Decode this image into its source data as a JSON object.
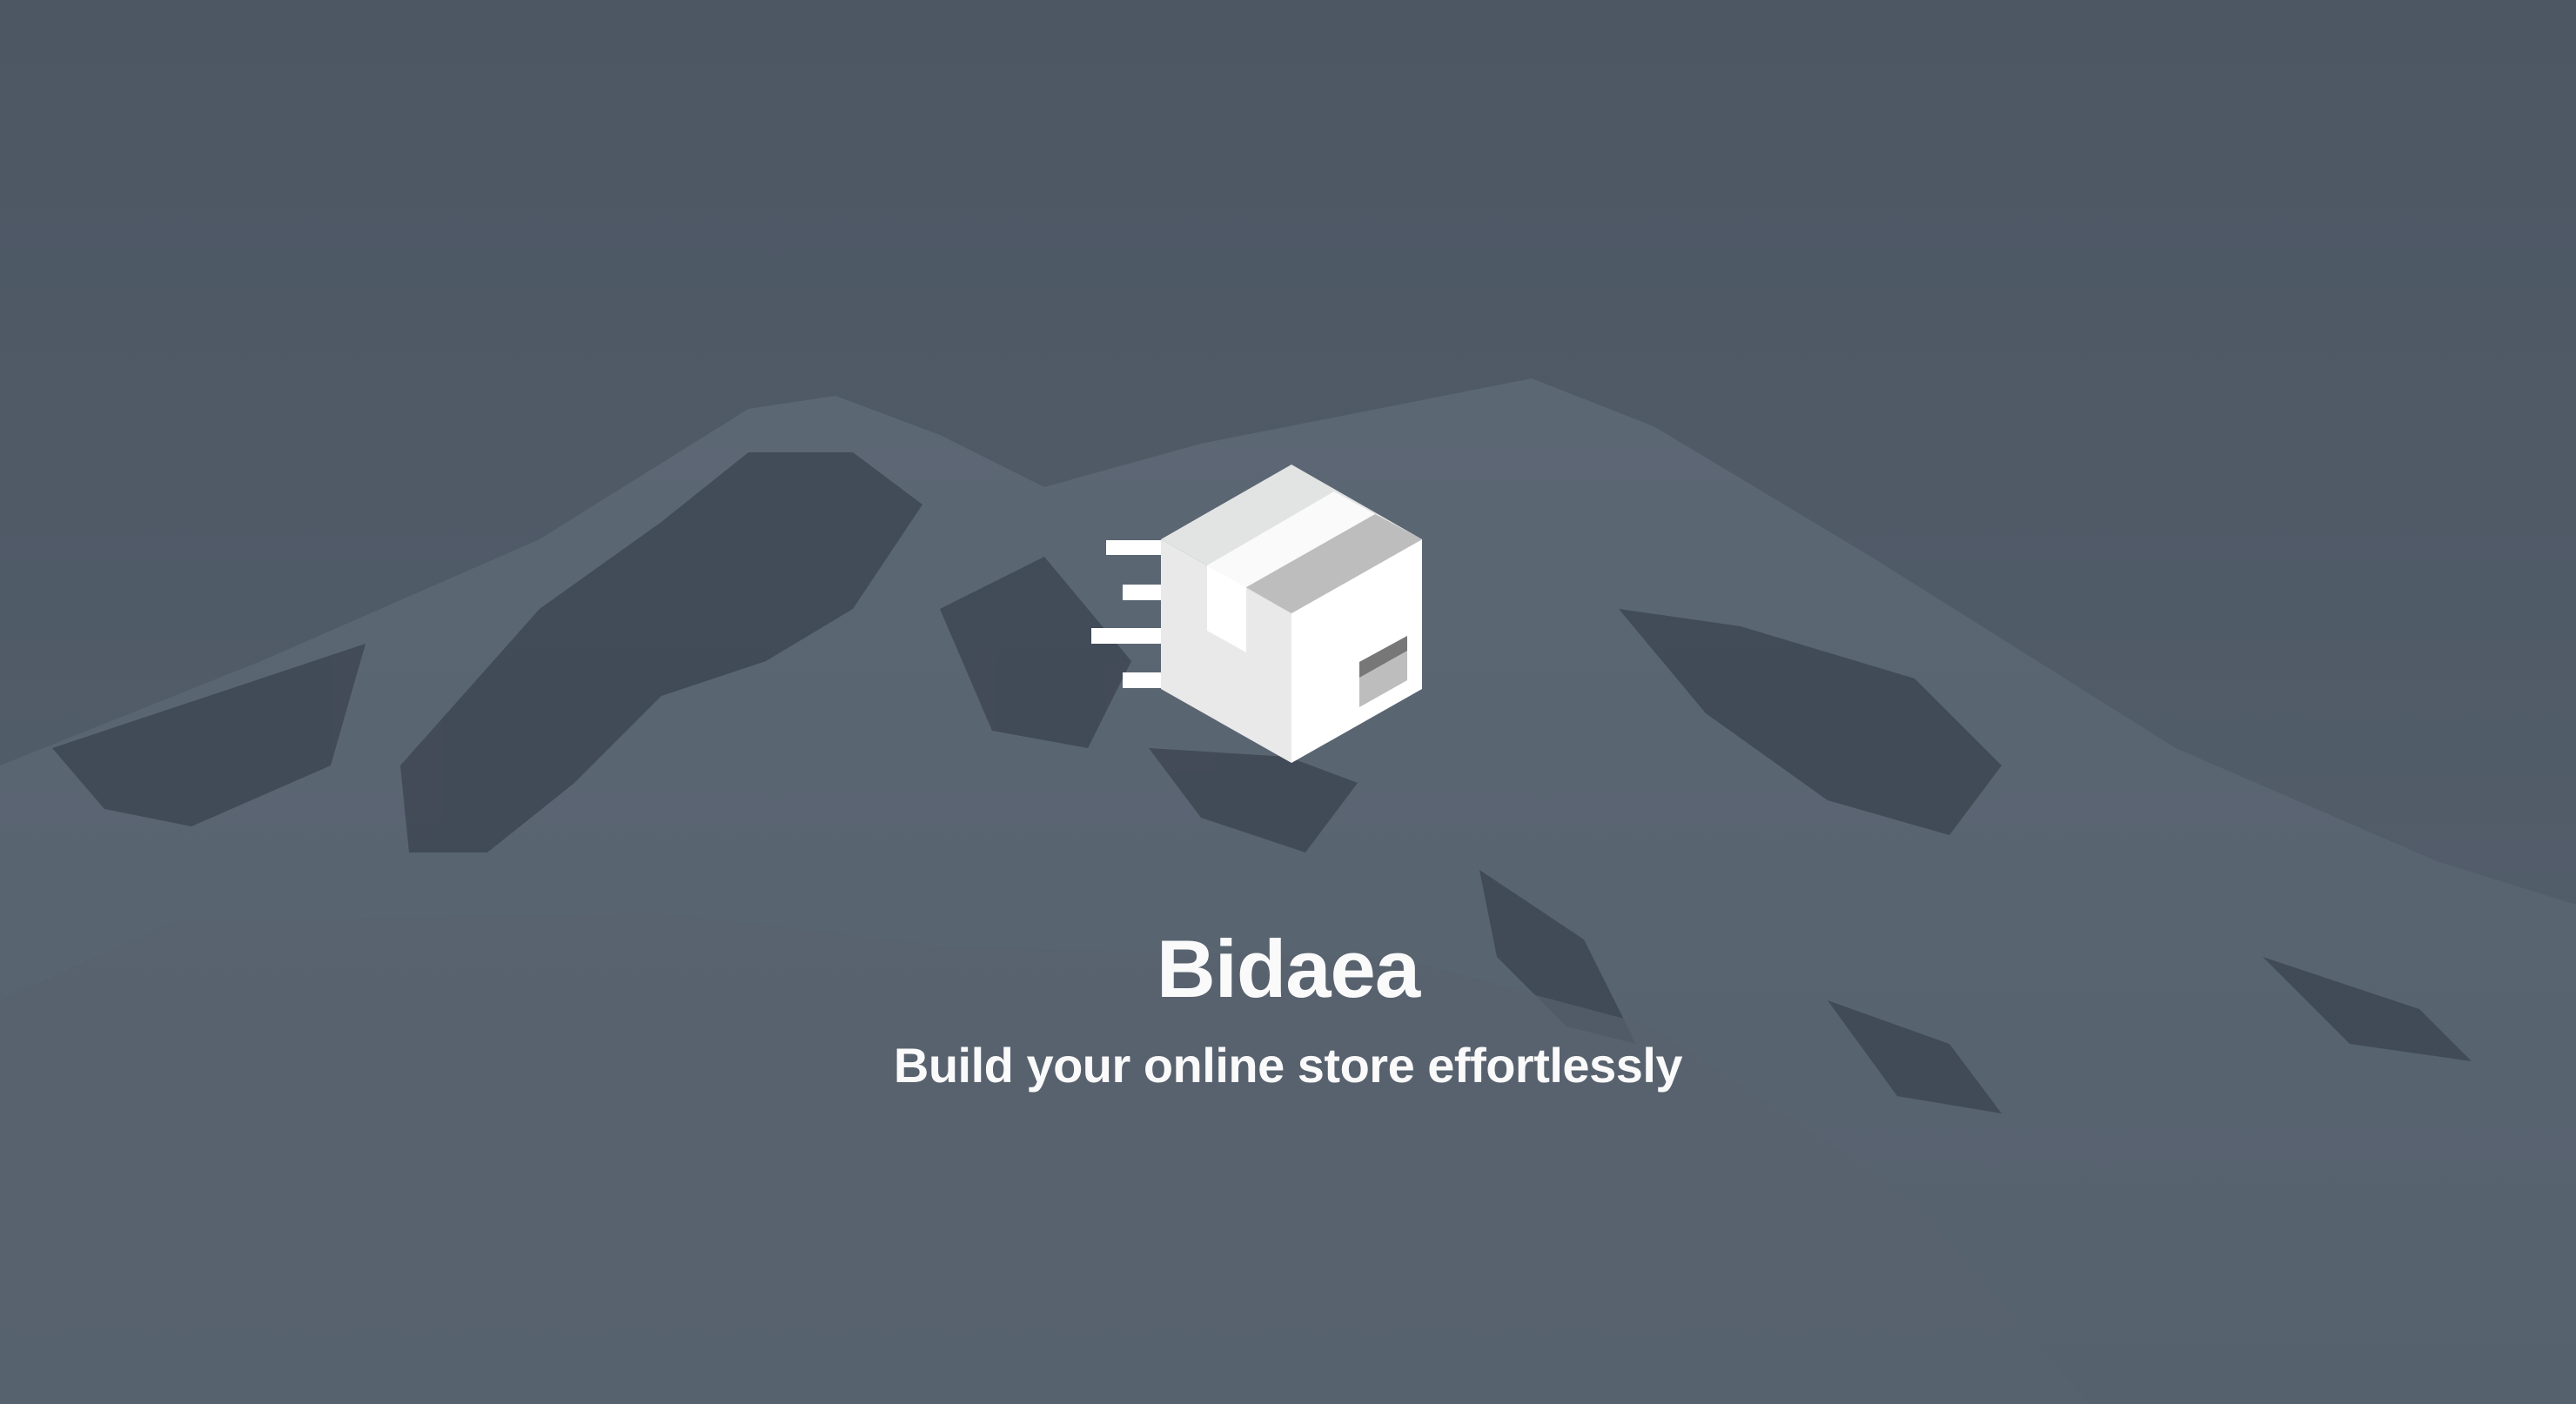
{
  "brand": {
    "name": "Bidaea",
    "tagline": "Build your online store effortlessly"
  },
  "logo": {
    "icon": "package-box-icon"
  },
  "colors": {
    "overlay": "#4e5866",
    "text": "#fafafa"
  }
}
